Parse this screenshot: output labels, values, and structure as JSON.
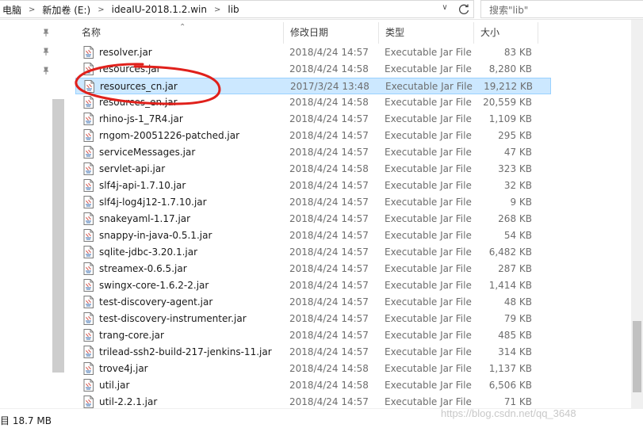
{
  "address": {
    "crumbs": [
      "电脑",
      "新加卷 (E:)",
      "ideaIU-2018.1.2.win",
      "lib"
    ]
  },
  "search": {
    "placeholder": "搜索\"lib\""
  },
  "columns": {
    "name": "名称",
    "date": "修改日期",
    "type": "类型",
    "size": "大小"
  },
  "files": [
    {
      "name": "resolver.jar",
      "date": "2018/4/24 14:57",
      "type": "Executable Jar File",
      "size": "83 KB"
    },
    {
      "name": "resources.jar",
      "date": "2018/4/24 14:58",
      "type": "Executable Jar File",
      "size": "8,280 KB"
    },
    {
      "name": "resources_cn.jar",
      "date": "2017/3/24 13:48",
      "type": "Executable Jar File",
      "size": "19,212 KB"
    },
    {
      "name": "resources_en.jar",
      "date": "2018/4/24 14:58",
      "type": "Executable Jar File",
      "size": "20,559 KB"
    },
    {
      "name": "rhino-js-1_7R4.jar",
      "date": "2018/4/24 14:57",
      "type": "Executable Jar File",
      "size": "1,109 KB"
    },
    {
      "name": "rngom-20051226-patched.jar",
      "date": "2018/4/24 14:57",
      "type": "Executable Jar File",
      "size": "295 KB"
    },
    {
      "name": "serviceMessages.jar",
      "date": "2018/4/24 14:57",
      "type": "Executable Jar File",
      "size": "47 KB"
    },
    {
      "name": "servlet-api.jar",
      "date": "2018/4/24 14:58",
      "type": "Executable Jar File",
      "size": "323 KB"
    },
    {
      "name": "slf4j-api-1.7.10.jar",
      "date": "2018/4/24 14:57",
      "type": "Executable Jar File",
      "size": "32 KB"
    },
    {
      "name": "slf4j-log4j12-1.7.10.jar",
      "date": "2018/4/24 14:57",
      "type": "Executable Jar File",
      "size": "9 KB"
    },
    {
      "name": "snakeyaml-1.17.jar",
      "date": "2018/4/24 14:57",
      "type": "Executable Jar File",
      "size": "268 KB"
    },
    {
      "name": "snappy-in-java-0.5.1.jar",
      "date": "2018/4/24 14:57",
      "type": "Executable Jar File",
      "size": "54 KB"
    },
    {
      "name": "sqlite-jdbc-3.20.1.jar",
      "date": "2018/4/24 14:57",
      "type": "Executable Jar File",
      "size": "6,482 KB"
    },
    {
      "name": "streamex-0.6.5.jar",
      "date": "2018/4/24 14:57",
      "type": "Executable Jar File",
      "size": "287 KB"
    },
    {
      "name": "swingx-core-1.6.2-2.jar",
      "date": "2018/4/24 14:57",
      "type": "Executable Jar File",
      "size": "1,414 KB"
    },
    {
      "name": "test-discovery-agent.jar",
      "date": "2018/4/24 14:57",
      "type": "Executable Jar File",
      "size": "48 KB"
    },
    {
      "name": "test-discovery-instrumenter.jar",
      "date": "2018/4/24 14:57",
      "type": "Executable Jar File",
      "size": "79 KB"
    },
    {
      "name": "trang-core.jar",
      "date": "2018/4/24 14:57",
      "type": "Executable Jar File",
      "size": "485 KB"
    },
    {
      "name": "trilead-ssh2-build-217-jenkins-11.jar",
      "date": "2018/4/24 14:57",
      "type": "Executable Jar File",
      "size": "314 KB"
    },
    {
      "name": "trove4j.jar",
      "date": "2018/4/24 14:58",
      "type": "Executable Jar File",
      "size": "1,137 KB"
    },
    {
      "name": "util.jar",
      "date": "2018/4/24 14:58",
      "type": "Executable Jar File",
      "size": "6,506 KB"
    },
    {
      "name": "util-2.2.1.jar",
      "date": "2018/4/24 14:57",
      "type": "Executable Jar File",
      "size": "71 KB"
    }
  ],
  "selected_index": 2,
  "status": {
    "size_text": "目 18.7 MB"
  },
  "watermark": "https://blog.csdn.net/qq_3648",
  "colors": {
    "selection_bg": "#cce8ff",
    "selection_border": "#99d1ff",
    "annotation": "#e0201b"
  }
}
